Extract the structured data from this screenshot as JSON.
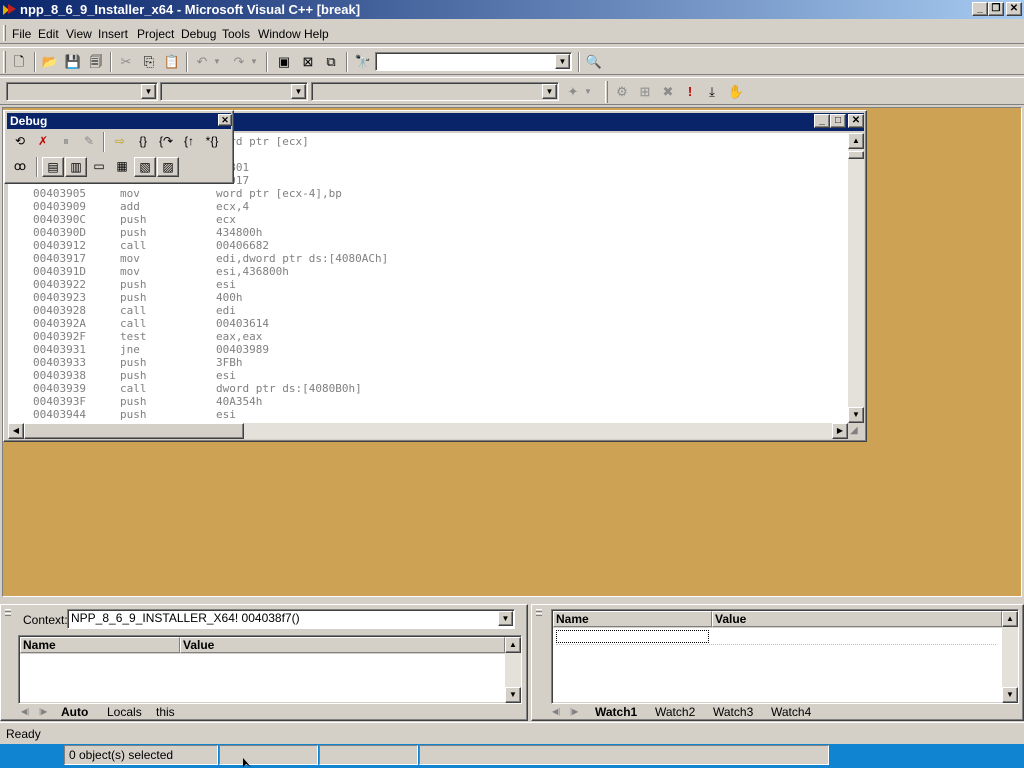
{
  "window": {
    "title": "npp_8_6_9_Installer_x64 - Microsoft Visual C++ [break]",
    "minimize": "_",
    "restore": "❐",
    "close": "✕"
  },
  "menu": [
    "File",
    "Edit",
    "View",
    "Insert",
    "Project",
    "Debug",
    "Tools",
    "Window",
    "Help"
  ],
  "debug_toolbar": {
    "title": "Debug",
    "close": "✕"
  },
  "disassembly": {
    "partial_lines": [
      "word ptr [ecx]",
      "bp",
      "03801",
      "03917"
    ],
    "rows": [
      {
        "addr": "00403905",
        "mnemonic": "mov",
        "operand": "word ptr [ecx-4],bp"
      },
      {
        "addr": "00403909",
        "mnemonic": "add",
        "operand": "ecx,4"
      },
      {
        "addr": "0040390C",
        "mnemonic": "push",
        "operand": "ecx"
      },
      {
        "addr": "0040390D",
        "mnemonic": "push",
        "operand": "434800h"
      },
      {
        "addr": "00403912",
        "mnemonic": "call",
        "operand": "00406682"
      },
      {
        "addr": "00403917",
        "mnemonic": "mov",
        "operand": "edi,dword ptr ds:[4080ACh]"
      },
      {
        "addr": "0040391D",
        "mnemonic": "mov",
        "operand": "esi,436800h"
      },
      {
        "addr": "00403922",
        "mnemonic": "push",
        "operand": "esi"
      },
      {
        "addr": "00403923",
        "mnemonic": "push",
        "operand": "400h"
      },
      {
        "addr": "00403928",
        "mnemonic": "call",
        "operand": "edi"
      },
      {
        "addr": "0040392A",
        "mnemonic": "call",
        "operand": "00403614"
      },
      {
        "addr": "0040392F",
        "mnemonic": "test",
        "operand": "eax,eax"
      },
      {
        "addr": "00403931",
        "mnemonic": "jne",
        "operand": "00403989"
      },
      {
        "addr": "00403933",
        "mnemonic": "push",
        "operand": "3FBh"
      },
      {
        "addr": "00403938",
        "mnemonic": "push",
        "operand": "esi"
      },
      {
        "addr": "00403939",
        "mnemonic": "call",
        "operand": "dword ptr ds:[4080B0h]"
      },
      {
        "addr": "0040393F",
        "mnemonic": "push",
        "operand": "40A354h"
      },
      {
        "addr": "00403944",
        "mnemonic": "push",
        "operand": "esi"
      }
    ]
  },
  "variables_pane": {
    "context_label": "Context:",
    "context_value": "NPP_8_6_9_INSTALLER_X64! 004038f7()",
    "columns": [
      "Name",
      "Value"
    ],
    "tabs": [
      "Auto",
      "Locals",
      "this"
    ]
  },
  "watch_pane": {
    "columns": [
      "Name",
      "Value"
    ],
    "tabs": [
      "Watch1",
      "Watch2",
      "Watch3",
      "Watch4"
    ]
  },
  "status": {
    "text": "Ready",
    "selection": "0 object(s) selected"
  }
}
